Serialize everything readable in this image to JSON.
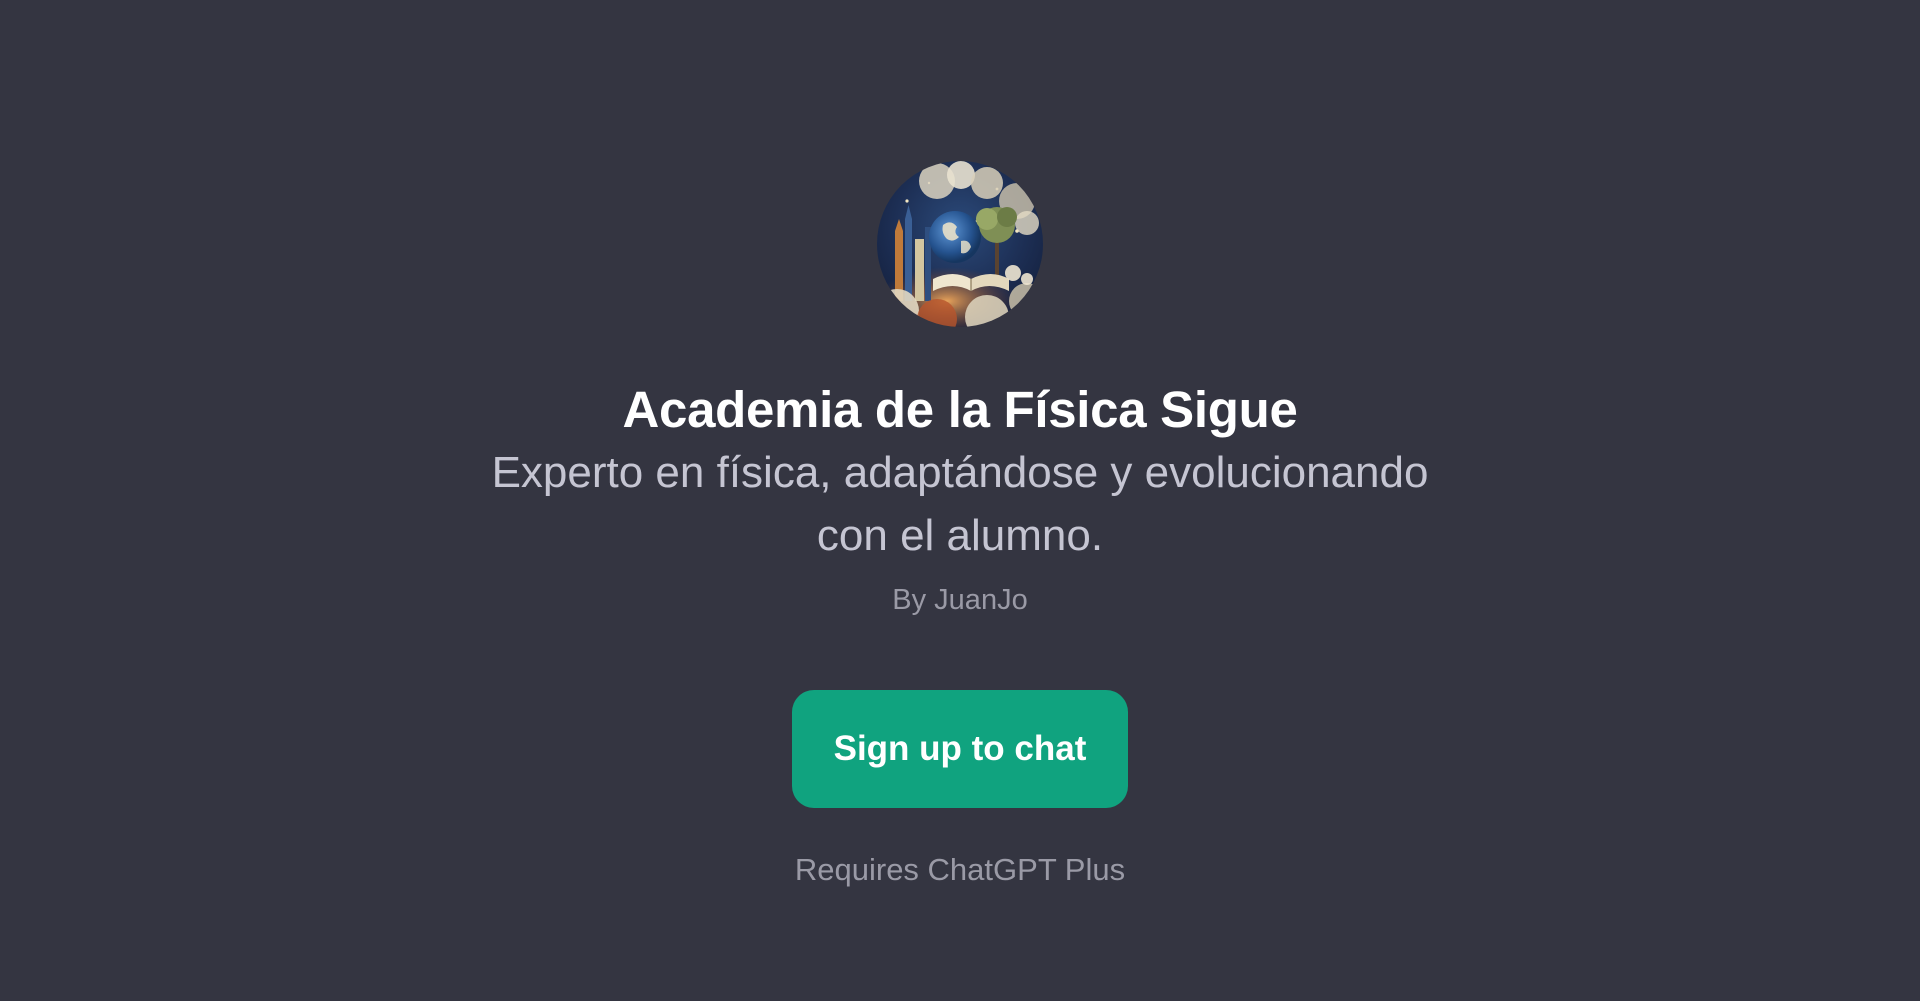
{
  "gpt": {
    "avatar_icon": "gpt-avatar-physics-illustration",
    "title": "Academia de la Física Sigue",
    "description": "Experto en física, adaptándose y evolucionando con el alumno.",
    "author": "By JuanJo"
  },
  "actions": {
    "signup_label": "Sign up to chat",
    "requirement_note": "Requires ChatGPT Plus"
  },
  "colors": {
    "background": "#343541",
    "accent": "#10a37f",
    "title": "#ffffff",
    "description": "#c5c5d2",
    "muted": "#9a9aa6"
  }
}
